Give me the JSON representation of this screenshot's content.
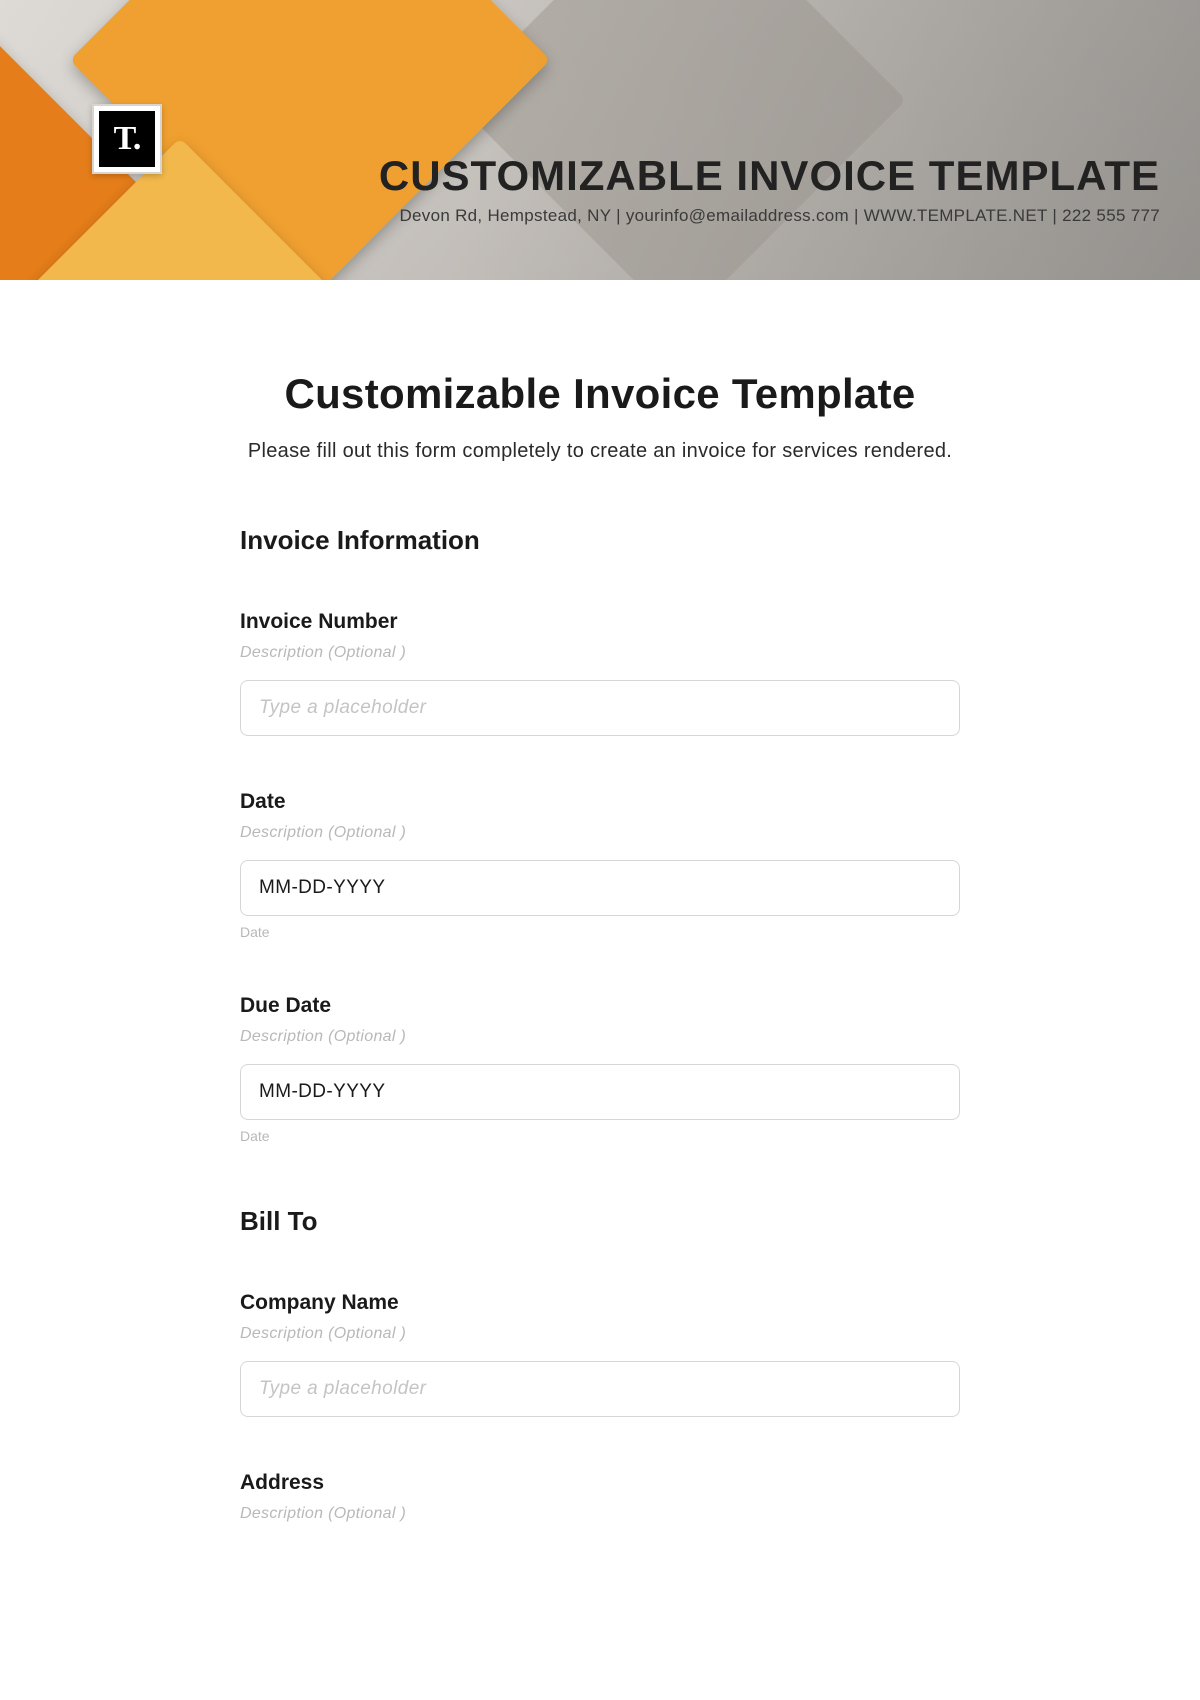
{
  "banner": {
    "logo_text": "T.",
    "title": "CUSTOMIZABLE INVOICE TEMPLATE",
    "subline": "Devon Rd, Hempstead, NY | yourinfo@emailaddress.com | WWW.TEMPLATE.NET | 222 555 777"
  },
  "page": {
    "title": "Customizable Invoice Template",
    "subtitle": "Please fill out this form completely to create an invoice for services rendered."
  },
  "sections": {
    "invoice_info_title": "Invoice Information",
    "bill_to_title": "Bill To"
  },
  "fields": {
    "invoice_number": {
      "label": "Invoice Number",
      "desc": "Description  (Optional )",
      "placeholder": "Type a placeholder"
    },
    "date": {
      "label": "Date",
      "desc": "Description  (Optional )",
      "placeholder": "MM-DD-YYYY",
      "hint": "Date"
    },
    "due_date": {
      "label": "Due Date",
      "desc": "Description  (Optional )",
      "placeholder": "MM-DD-YYYY",
      "hint": "Date"
    },
    "company_name": {
      "label": "Company Name",
      "desc": "Description  (Optional )",
      "placeholder": "Type a placeholder"
    },
    "address": {
      "label": "Address",
      "desc": "Description  (Optional )"
    }
  }
}
